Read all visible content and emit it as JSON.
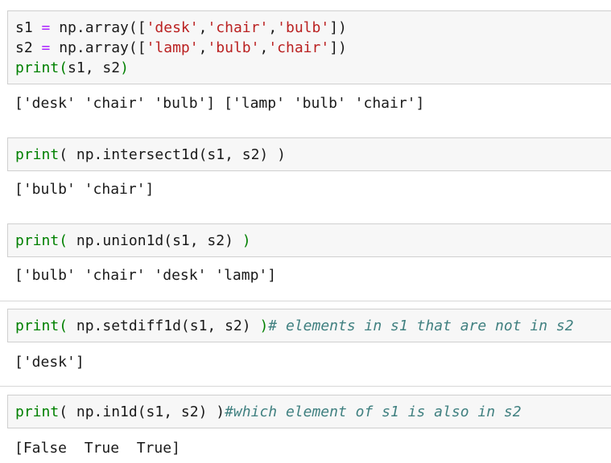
{
  "cells": [
    {
      "input_lines": [
        [
          {
            "t": "s1 ",
            "c": "pl"
          },
          {
            "t": "=",
            "c": "op"
          },
          {
            "t": " np.array([",
            "c": "pl"
          },
          {
            "t": "'desk'",
            "c": "str"
          },
          {
            "t": ",",
            "c": "pl"
          },
          {
            "t": "'chair'",
            "c": "str"
          },
          {
            "t": ",",
            "c": "pl"
          },
          {
            "t": "'bulb'",
            "c": "str"
          },
          {
            "t": "])",
            "c": "pl"
          }
        ],
        [
          {
            "t": "s2 ",
            "c": "pl"
          },
          {
            "t": "=",
            "c": "op"
          },
          {
            "t": " np.array([",
            "c": "pl"
          },
          {
            "t": "'lamp'",
            "c": "str"
          },
          {
            "t": ",",
            "c": "pl"
          },
          {
            "t": "'bulb'",
            "c": "str"
          },
          {
            "t": ",",
            "c": "pl"
          },
          {
            "t": "'chair'",
            "c": "str"
          },
          {
            "t": "])",
            "c": "pl"
          }
        ],
        [
          {
            "t": "print",
            "c": "kw"
          },
          {
            "t": "(",
            "c": "kw"
          },
          {
            "t": "s1, s2",
            "c": "pl"
          },
          {
            "t": ")",
            "c": "kw"
          }
        ]
      ],
      "output": "['desk' 'chair' 'bulb'] ['lamp' 'bulb' 'chair']"
    },
    {
      "input_lines": [
        [
          {
            "t": "print",
            "c": "kw"
          },
          {
            "t": "( np.intersect1d(s1, s2) )",
            "c": "pl"
          }
        ]
      ],
      "output": "['bulb' 'chair']"
    },
    {
      "input_lines": [
        [
          {
            "t": "print",
            "c": "kw"
          },
          {
            "t": "(",
            "c": "kw"
          },
          {
            "t": " np.union1d(s1, s2) ",
            "c": "pl"
          },
          {
            "t": ")",
            "c": "kw"
          }
        ]
      ],
      "output": "['bulb' 'chair' 'desk' 'lamp']"
    },
    {
      "input_lines": [
        [
          {
            "t": "print",
            "c": "kw"
          },
          {
            "t": "(",
            "c": "kw"
          },
          {
            "t": " np.setdiff1d(s1, s2) ",
            "c": "pl"
          },
          {
            "t": ")",
            "c": "kw"
          },
          {
            "t": "# elements in s1 that are not in s2",
            "c": "cm"
          }
        ]
      ],
      "output": "['desk']"
    },
    {
      "input_lines": [
        [
          {
            "t": "print",
            "c": "kw"
          },
          {
            "t": "( np.in1d(s1, s2) )",
            "c": "pl"
          },
          {
            "t": "#which element of s1 is also in s2",
            "c": "cm"
          }
        ]
      ],
      "output": "[False  True  True]"
    }
  ]
}
